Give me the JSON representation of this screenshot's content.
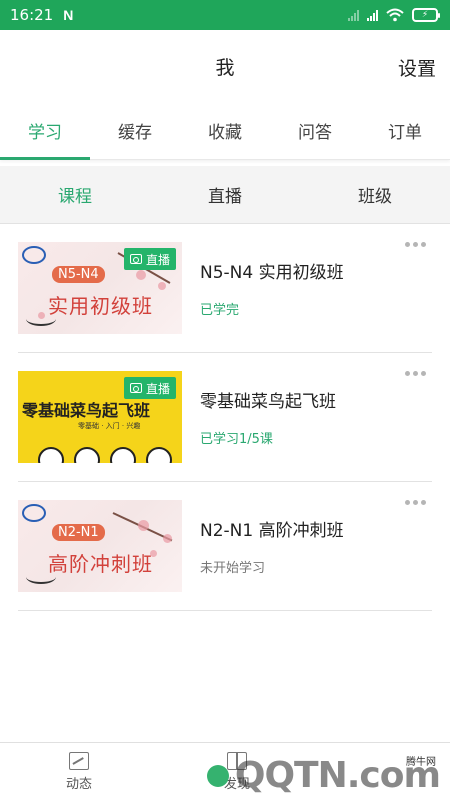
{
  "status_bar": {
    "time": "16:21",
    "notification_icon": "N",
    "battery": "⚡"
  },
  "header": {
    "title": "我",
    "settings_label": "设置"
  },
  "tabs": [
    {
      "label": "学习",
      "active": true
    },
    {
      "label": "缓存",
      "active": false
    },
    {
      "label": "收藏",
      "active": false
    },
    {
      "label": "问答",
      "active": false
    },
    {
      "label": "订单",
      "active": false
    }
  ],
  "subtabs": [
    {
      "label": "课程",
      "active": true
    },
    {
      "label": "直播",
      "active": false
    },
    {
      "label": "班级",
      "active": false
    }
  ],
  "courses": [
    {
      "name": "N5-N4 实用初级班",
      "status": "已学完",
      "badge": "直播",
      "thumb_tag": "N5-N4",
      "thumb_title": "实用初级班"
    },
    {
      "name": "零基础菜鸟起飞班",
      "status": "已学习1/5课",
      "badge": "直播",
      "thumb_title": "零基础菜鸟起飞班",
      "thumb_sub": "零基础 · 入门 · 兴趣"
    },
    {
      "name": "N2-N1 高阶冲刺班",
      "status": "未开始学习",
      "badge": null,
      "thumb_tag": "N2-N1",
      "thumb_title": "高阶冲刺班"
    }
  ],
  "bottom_nav": [
    {
      "label": "动态",
      "icon": "chart-icon"
    },
    {
      "label": "发现",
      "icon": "book-icon"
    }
  ],
  "watermark": {
    "name": "腾牛网",
    "text": "QQTN.com"
  },
  "colors": {
    "primary": "#2aa870",
    "status_bar": "#1fa65a",
    "live_badge": "#24b46a"
  }
}
